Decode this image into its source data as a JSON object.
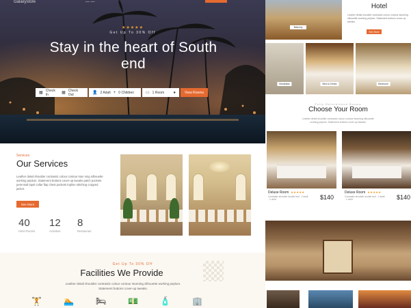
{
  "nav": {
    "logo": "Galaxystore",
    "menu": "— —"
  },
  "hero": {
    "stars": "★★★★★",
    "tagline": "Get Up To 30% Off",
    "title": "Stay in the heart of South end",
    "booking": {
      "checkin": "Check In",
      "checkout": "Check Out",
      "adults": "2 Adult",
      "children": "0 Children",
      "rooms": "1 Room",
      "button": "View Rooms"
    }
  },
  "services": {
    "eyebrow": "Services",
    "title": "Our Services",
    "description": "Leather detail shoulder contrastic colour contour stun ning silhouette working peplum. Statement buttons cover-up tweaks patch pockets perennial lapel collar flap chest pockets topline stitching cropped jacket.",
    "button": "See More",
    "stats": [
      {
        "value": "40",
        "label": "Hotel Rooms"
      },
      {
        "value": "12",
        "label": "Activities"
      },
      {
        "value": "8",
        "label": "Restaurant"
      }
    ]
  },
  "facilities": {
    "eyebrow": "Get Up To 30% Off",
    "title": "Facilities We Provide",
    "description": "Leather detail shoulder contrastic colour contour stunning silhouette working peplum. Statement buttons cover-up tweaks.",
    "icons": [
      "dumbbell-icon",
      "pool-icon",
      "bed-icon",
      "money-icon",
      "spa-icon",
      "building-icon"
    ],
    "glyphs": [
      "🏋",
      "🏊",
      "🛏",
      "💵",
      "🧴",
      "🏢"
    ]
  },
  "right": {
    "hotel_title": "Hotel",
    "hotel_desc": "Leather detail shoulder contrastic colour contour stunning silhouette working peplum. Statement buttons cover-up tweaks.",
    "hotel_button": "See More",
    "top_caption": "Balcony",
    "row_captions": [
      "Breakfast",
      "Bed & Drinks",
      "Bedroom"
    ],
    "choose_eyebrow": "Fully Refurbished Rooms",
    "choose_title": "Choose Your Room",
    "choose_desc": "Leather detail shoulder contrastic colour contour stunning silhouette working peplum. Statement buttons cover-up tweaks.",
    "rooms": [
      {
        "name": "Deluxe Room",
        "stars": "★★★★★",
        "desc": "Contrastic shoulder double bed · 2 adult · 1 child",
        "price": "$140"
      },
      {
        "name": "Deluxe Room",
        "stars": "★★★★★",
        "desc": "Contrastic shoulder double bed · 2 adult · 1 child",
        "price": "$140"
      }
    ]
  },
  "colors": {
    "accent": "#e56a30",
    "star": "#f0a030"
  }
}
